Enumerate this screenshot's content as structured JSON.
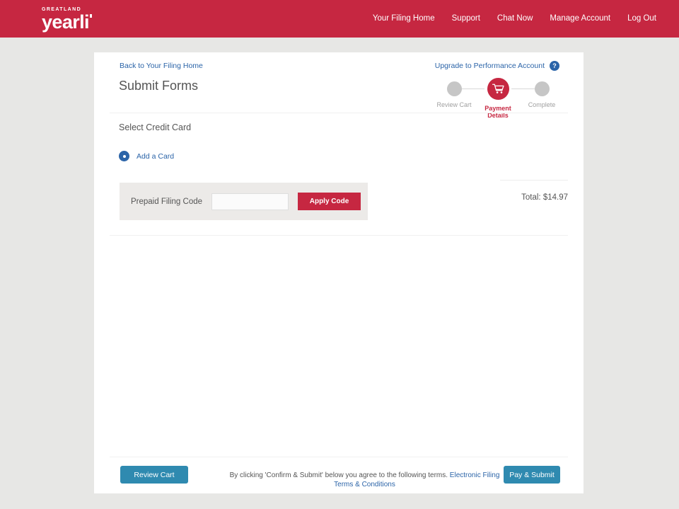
{
  "header": {
    "brand_sup": "GREATLAND",
    "brand_main": "yearli",
    "brand_color": "#c62741",
    "nav": [
      {
        "label": "Your Filing Home"
      },
      {
        "label": "Support"
      },
      {
        "label": "Chat Now"
      },
      {
        "label": "Manage Account"
      },
      {
        "label": "Log Out"
      }
    ]
  },
  "card": {
    "back_link": "Back to Your Filing Home",
    "title": "Submit Forms",
    "upgrade_link": "Upgrade to Performance Account",
    "help_icon_glyph": "?",
    "stepper": {
      "steps": [
        {
          "label": "Review Cart",
          "state": "inactive"
        },
        {
          "label": "Payment Details",
          "state": "active",
          "icon": "shopping-cart-icon"
        },
        {
          "label": "Complete",
          "state": "inactive"
        }
      ],
      "active_color": "#c62741",
      "inactive_color": "#c6c6c6"
    },
    "section_title": "Select Credit Card",
    "add_card": {
      "label": "Add a Card",
      "icon": "add-circle-icon",
      "color": "#2b64a8"
    },
    "prepaid": {
      "label": "Prepaid Filing Code",
      "input_value": "",
      "input_placeholder": "",
      "apply_label": "Apply Code",
      "apply_color": "#c62741"
    },
    "total": {
      "text": "Total: $14.97"
    }
  },
  "footer": {
    "review_cart_label": "Review Cart",
    "pay_submit_label": "Pay & Submit",
    "terms_text": "By clicking 'Confirm & Submit' below you agree to the following terms.",
    "terms_link": "Electronic Filing Terms & Conditions",
    "button_color": "#2f8ab0"
  }
}
